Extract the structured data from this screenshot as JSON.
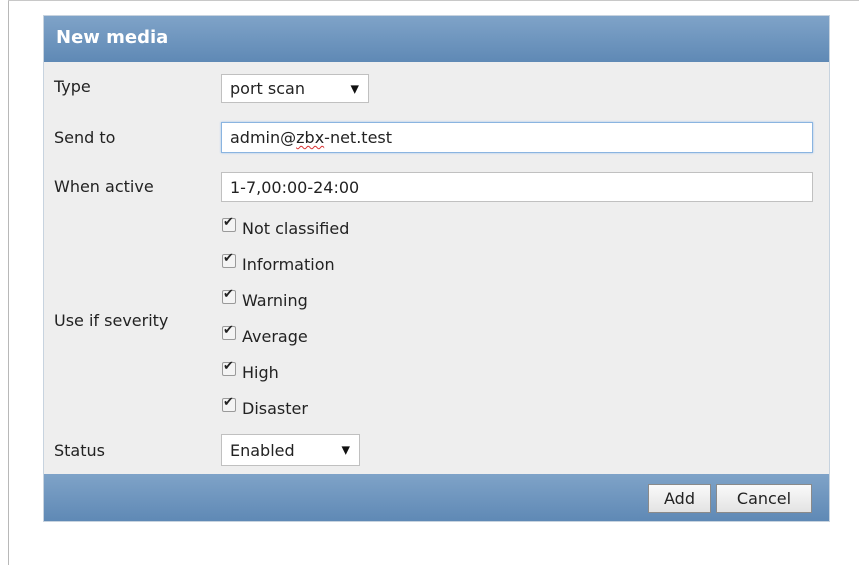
{
  "dialog": {
    "title": "New media",
    "type": {
      "label": "Type",
      "value": "port scan"
    },
    "send_to": {
      "label": "Send to",
      "value_prefix": "admin@",
      "value_misspelled": "zbx",
      "value_suffix": "-net.test"
    },
    "when_active": {
      "label": "When active",
      "value": "1-7,00:00-24:00"
    },
    "severity": {
      "label": "Use if severity",
      "items": [
        {
          "label": "Not classified",
          "checked": true
        },
        {
          "label": "Information",
          "checked": true
        },
        {
          "label": "Warning",
          "checked": true
        },
        {
          "label": "Average",
          "checked": true
        },
        {
          "label": "High",
          "checked": true
        },
        {
          "label": "Disaster",
          "checked": true
        }
      ]
    },
    "status": {
      "label": "Status",
      "value": "Enabled"
    },
    "buttons": {
      "add": "Add",
      "cancel": "Cancel"
    }
  },
  "icons": {
    "dropdown_arrow": "▼",
    "checkmark": "✔"
  },
  "colors": {
    "header_bar": "#6a92bd",
    "dialog_background": "#eeeeee",
    "focus_border": "#8ab4e0"
  }
}
